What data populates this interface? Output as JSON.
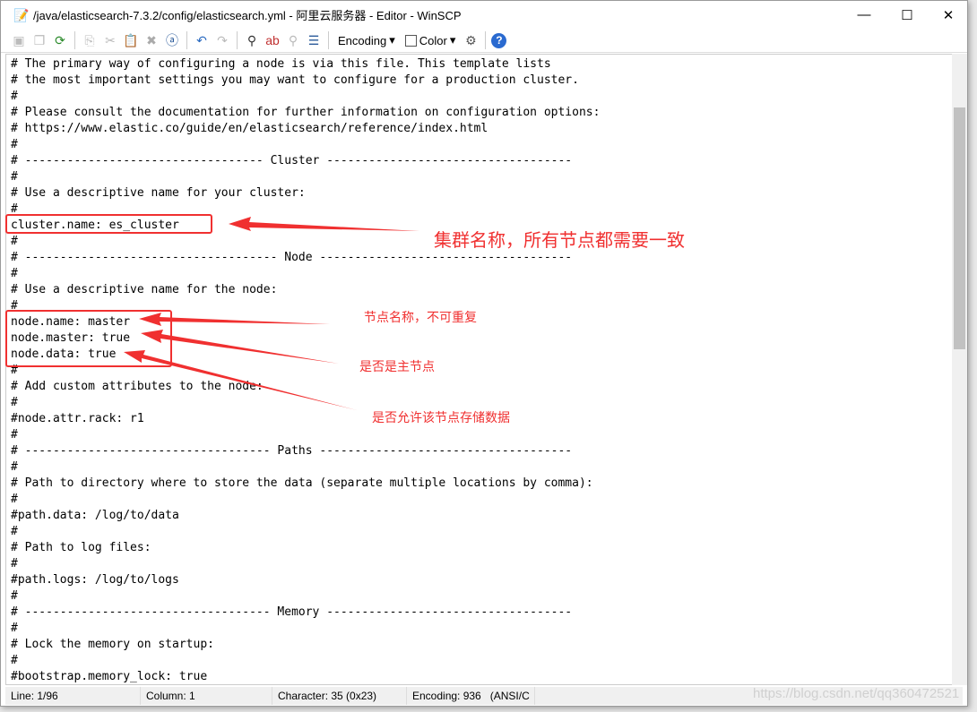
{
  "window": {
    "title": "/java/elasticsearch-7.3.2/config/elasticsearch.yml - 阿里云服务器 - Editor - WinSCP",
    "minimize": "—",
    "maximize": "☐",
    "close": "✕"
  },
  "toolbar": {
    "encoding": "Encoding",
    "color": "Color"
  },
  "code_lines": [
    "# The primary way of configuring a node is via this file. This template lists",
    "# the most important settings you may want to configure for a production cluster.",
    "#",
    "# Please consult the documentation for further information on configuration options:",
    "# https://www.elastic.co/guide/en/elasticsearch/reference/index.html",
    "#",
    "# ---------------------------------- Cluster -----------------------------------",
    "#",
    "# Use a descriptive name for your cluster:",
    "#",
    "cluster.name: es_cluster",
    "#",
    "# ------------------------------------ Node ------------------------------------",
    "#",
    "# Use a descriptive name for the node:",
    "#",
    "node.name: master",
    "node.master: true",
    "node.data: true",
    "#",
    "# Add custom attributes to the node:",
    "#",
    "#node.attr.rack: r1",
    "#",
    "# ----------------------------------- Paths ------------------------------------",
    "#",
    "# Path to directory where to store the data (separate multiple locations by comma):",
    "#",
    "#path.data: /log/to/data",
    "#",
    "# Path to log files:",
    "#",
    "#path.logs: /log/to/logs",
    "#",
    "# ----------------------------------- Memory -----------------------------------",
    "#",
    "# Lock the memory on startup:",
    "#",
    "#bootstrap.memory_lock: true"
  ],
  "annotations": {
    "cluster": "集群名称，所有节点都需要一致",
    "node_name": "节点名称，不可重复",
    "node_master": "是否是主节点",
    "node_data": "是否允许该节点存储数据",
    "color": "#f03030"
  },
  "status": {
    "line": "Line: 1/96",
    "column": "Column: 1",
    "character": "Character: 35 (0x23)",
    "encoding": "Encoding: 936   (ANSI/C"
  },
  "watermark": "https://blog.csdn.net/qq360472521"
}
